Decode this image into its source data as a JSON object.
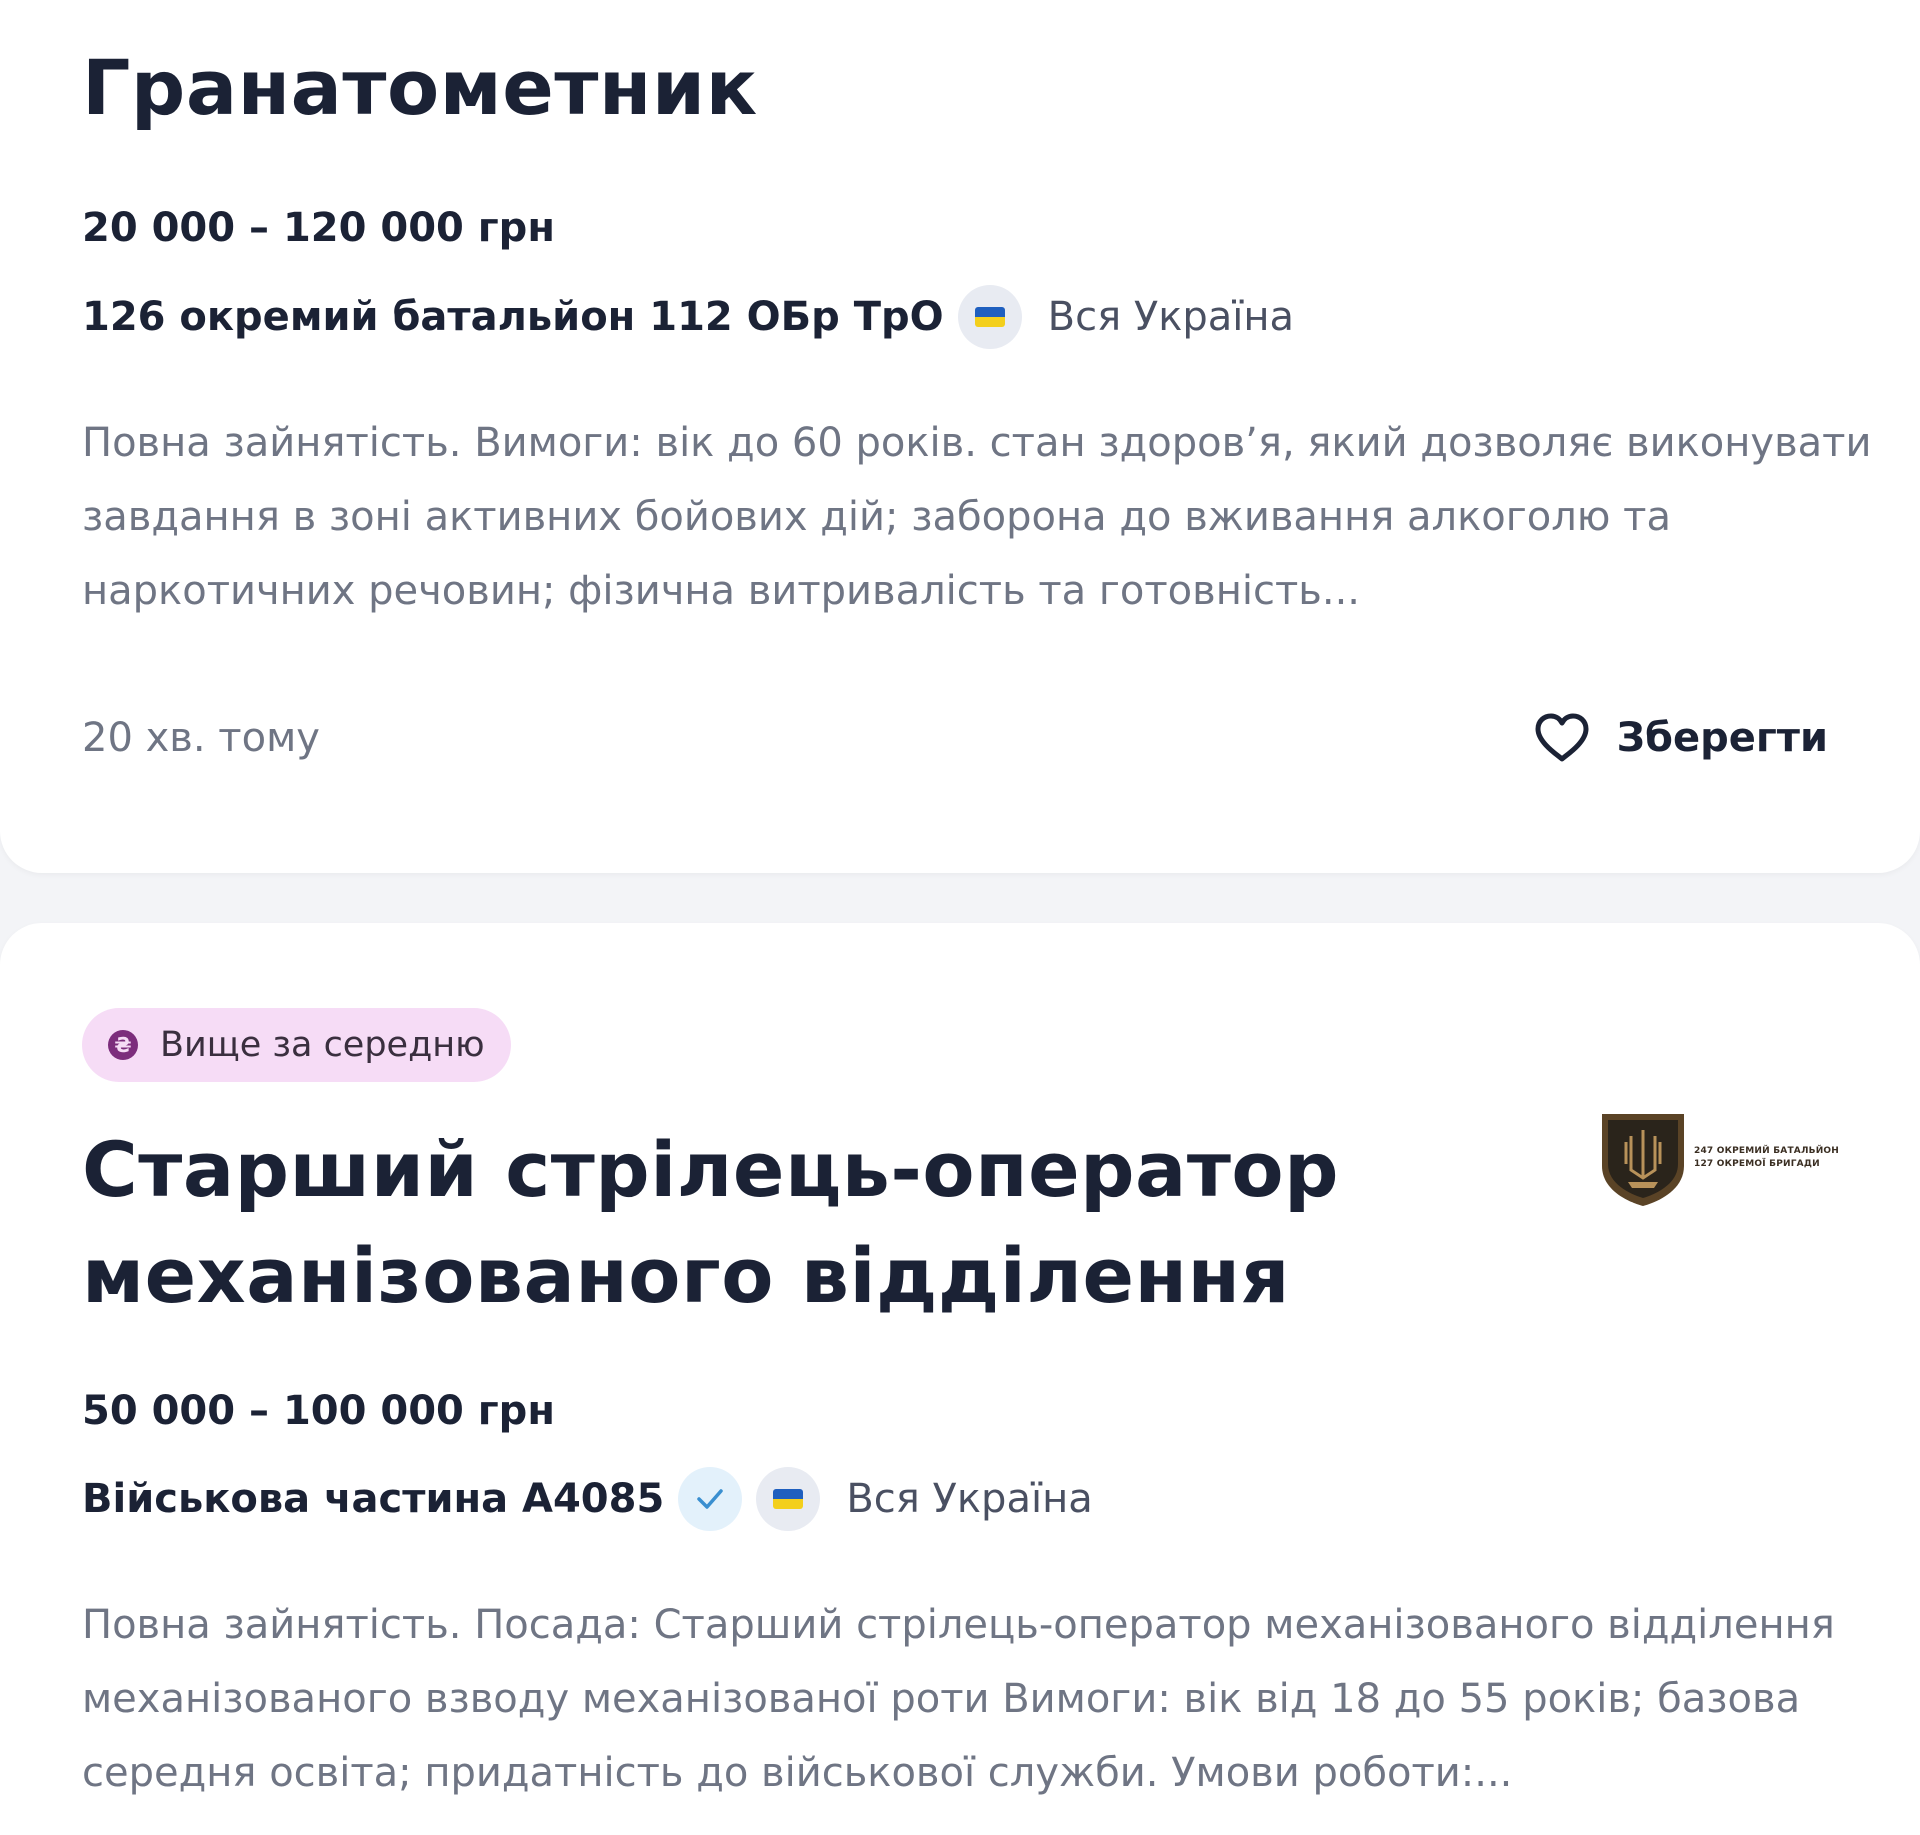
{
  "vacancies": [
    {
      "title": "Гранатометник",
      "salary": "20 000 – 120 000 грн",
      "company": "126 окремий батальйон 112 ОБр ТрО",
      "location": "Вся Україна",
      "description": "Повна зайнятість. Вимоги: вік до 60 років. стан здоров’я, який дозволяє виконувати завдання в зоні активних бойових дій; заборона до вживання алкоголю та наркотичних речовин; фізична витривалість та готовність...",
      "posted": "20 хв. тому",
      "save_label": "Зберегти",
      "icons": {
        "flag": "ukraine-flag-icon",
        "save": "heart-icon"
      }
    },
    {
      "tag": "Вище за середню",
      "title": "Старший стрілець-оператор механізованого відділення",
      "salary": "50 000 – 100 000 грн",
      "company": "Військова частина А4085",
      "verified": true,
      "location": "Вся Україна",
      "description": "Повна зайнятість. Посада: Старший стрілець-оператор механізованого відділення механізованого взводу механізованої роти Вимоги: вік від 18 до 55 років; базова середня освіта; придатність до військової служби. Умови роботи:...",
      "logo_lines": [
        "247 ОКРЕМИЙ БАТАЛЬЙОН",
        "127 ОКРЕМОЇ БРИГАДИ"
      ],
      "icons": {
        "tag": "coin-icon",
        "verified": "check-icon",
        "flag": "ukraine-flag-icon"
      }
    }
  ],
  "colors": {
    "page_bg": "#f3f4f7",
    "card_bg": "#ffffff",
    "title": "#1b2235",
    "muted_text": "#6f7584",
    "tag_bg": "#f6dcf6",
    "tag_icon": "#7c2d7c",
    "flag_blue": "#1f5fbf",
    "flag_yellow": "#f3cf1c",
    "verified_bg": "#e3f1fb",
    "verified_check": "#3a8fd0"
  }
}
